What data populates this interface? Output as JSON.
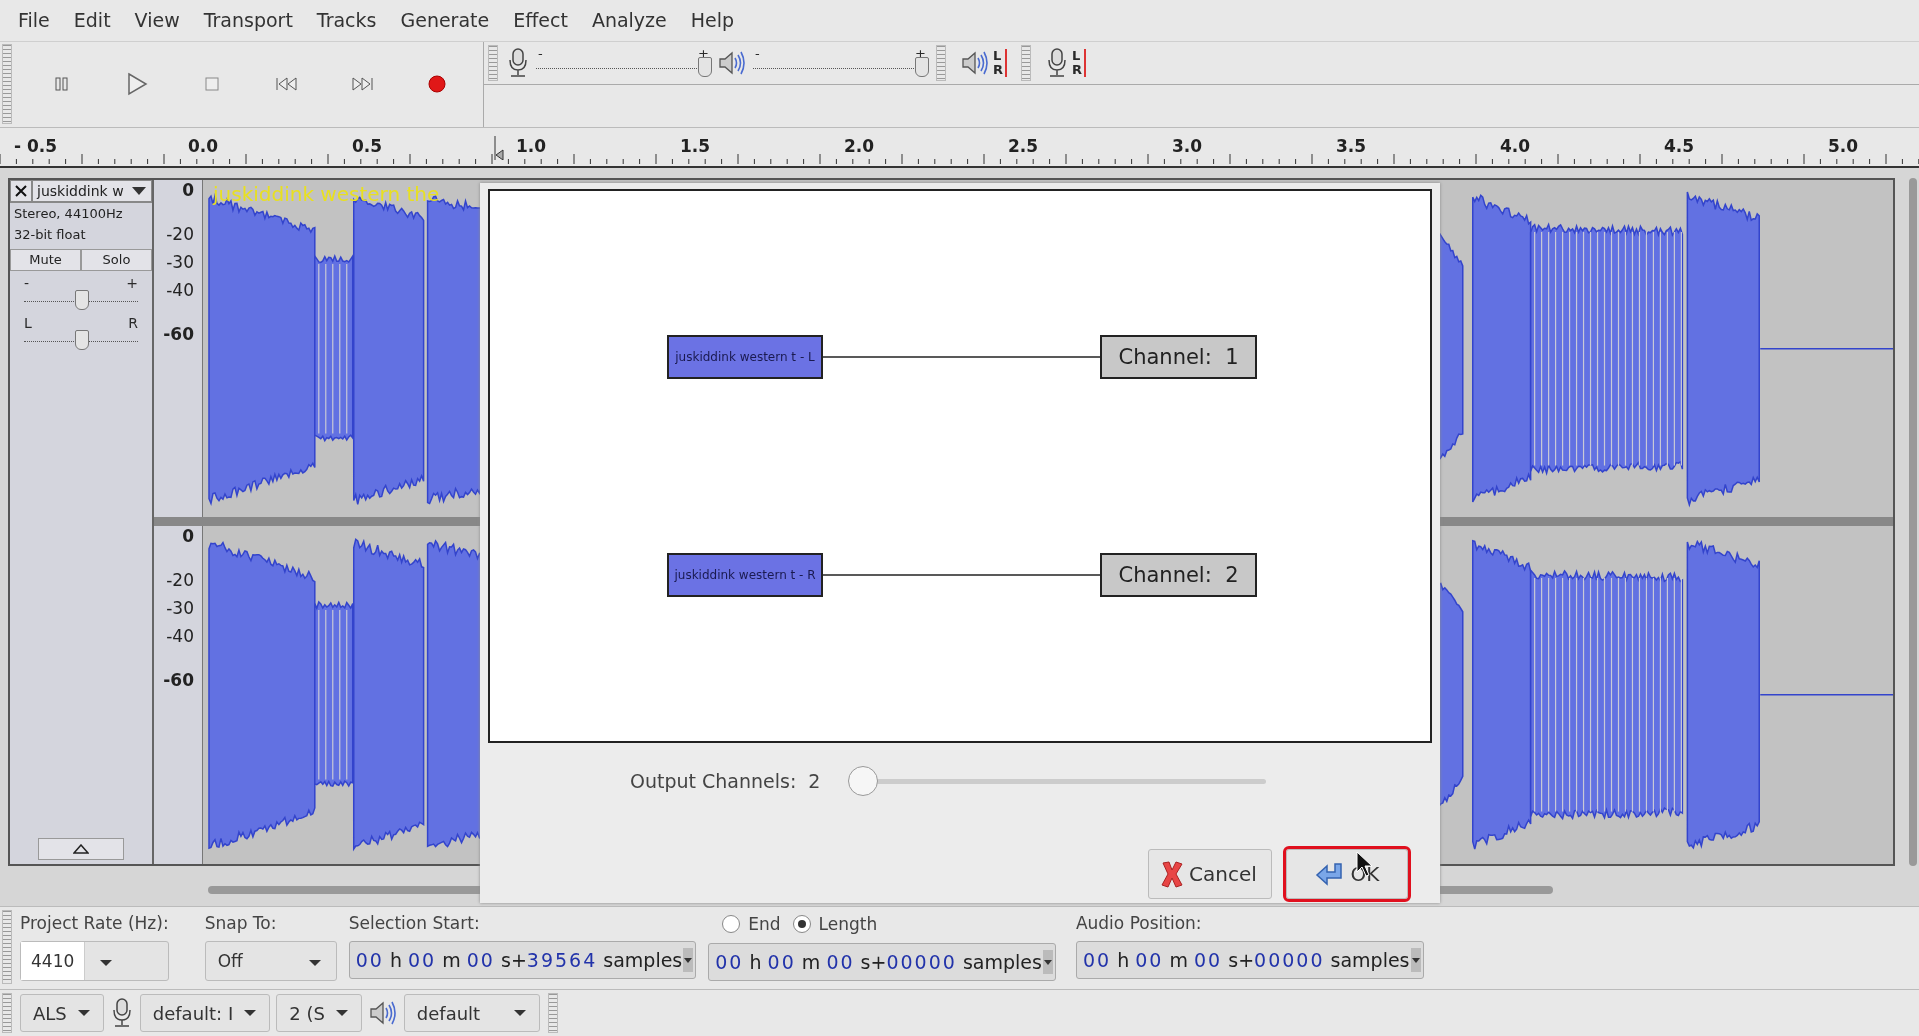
{
  "menu": [
    "File",
    "Edit",
    "View",
    "Transport",
    "Tracks",
    "Generate",
    "Effect",
    "Analyze",
    "Help"
  ],
  "transport": [
    {
      "kind": "pause"
    },
    {
      "kind": "play"
    },
    {
      "kind": "stop"
    },
    {
      "kind": "skip_start"
    },
    {
      "kind": "skip_end"
    },
    {
      "kind": "record"
    }
  ],
  "mixer": {
    "record_slider": {
      "min": "-",
      "max": "+",
      "level": 0.96
    },
    "play_slider": {
      "min": "-",
      "max": "+",
      "level": 0.96
    }
  },
  "meters": [
    {
      "kind": "playback",
      "left": "L",
      "right": "R"
    },
    {
      "kind": "record",
      "left": "L",
      "right": "R"
    }
  ],
  "ruler": [
    "- 0.5",
    "0.0",
    "0.5",
    "1.0",
    "1.5",
    "2.0",
    "2.5",
    "3.0",
    "3.5",
    "4.0",
    "4.5",
    "5.0"
  ],
  "track": {
    "name": "juskiddink w",
    "info": [
      "Stereo, 44100Hz",
      "32-bit float"
    ],
    "mute": "Mute",
    "solo": "Solo",
    "gain": {
      "min": "-",
      "max": "+",
      "level": 0.5
    },
    "pan": {
      "left": "L",
      "right": "R",
      "level": 0.5
    },
    "overlay_title": "juskiddink western the",
    "channels": [
      {
        "scale": [
          "0",
          "-20",
          "-30",
          "-40",
          "-60"
        ]
      },
      {
        "scale": [
          "0",
          "-20",
          "-30",
          "-40",
          "-60"
        ]
      }
    ]
  },
  "dialog": {
    "inputs": [
      "juskiddink western t - L",
      "juskiddink western t - R"
    ],
    "outputs": [
      "Channel:  1",
      "Channel:  2"
    ],
    "output_channels": {
      "label": "Output Channels:",
      "value": "2",
      "level": 0
    },
    "buttons": [
      {
        "kind": "cancel",
        "label": "Cancel",
        "highlighted": false
      },
      {
        "kind": "ok",
        "label": "OK",
        "highlighted": true
      }
    ]
  },
  "selection_toolbar": {
    "project_rate": {
      "label": "Project Rate (Hz):",
      "value": "4410"
    },
    "snap": {
      "label": "Snap To:",
      "value": "Off"
    },
    "selection_start": {
      "label": "Selection Start:",
      "time": [
        {
          "digits": "00",
          "unit": " h "
        },
        {
          "digits": "00",
          "unit": " m "
        },
        {
          "digits": "00",
          "unit": " s+"
        },
        {
          "digits": "39564",
          "unit": " samples"
        }
      ]
    },
    "end_options": [
      {
        "label": "End",
        "selected": false
      },
      {
        "label": "Length",
        "selected": true
      }
    ],
    "length": {
      "time": [
        {
          "digits": "00",
          "unit": " h "
        },
        {
          "digits": "00",
          "unit": " m "
        },
        {
          "digits": "00",
          "unit": " s+"
        },
        {
          "digits": "00000",
          "unit": " samples"
        }
      ]
    },
    "audio_position": {
      "label": "Audio Position:",
      "time": [
        {
          "digits": "00",
          "unit": " h "
        },
        {
          "digits": "00",
          "unit": " m "
        },
        {
          "digits": "00",
          "unit": " s+"
        },
        {
          "digits": "00000",
          "unit": " samples"
        }
      ]
    }
  },
  "device_toolbar": {
    "host": "ALS",
    "recording_device": "default: I",
    "channels": "2 (S",
    "playback_device": "default"
  }
}
